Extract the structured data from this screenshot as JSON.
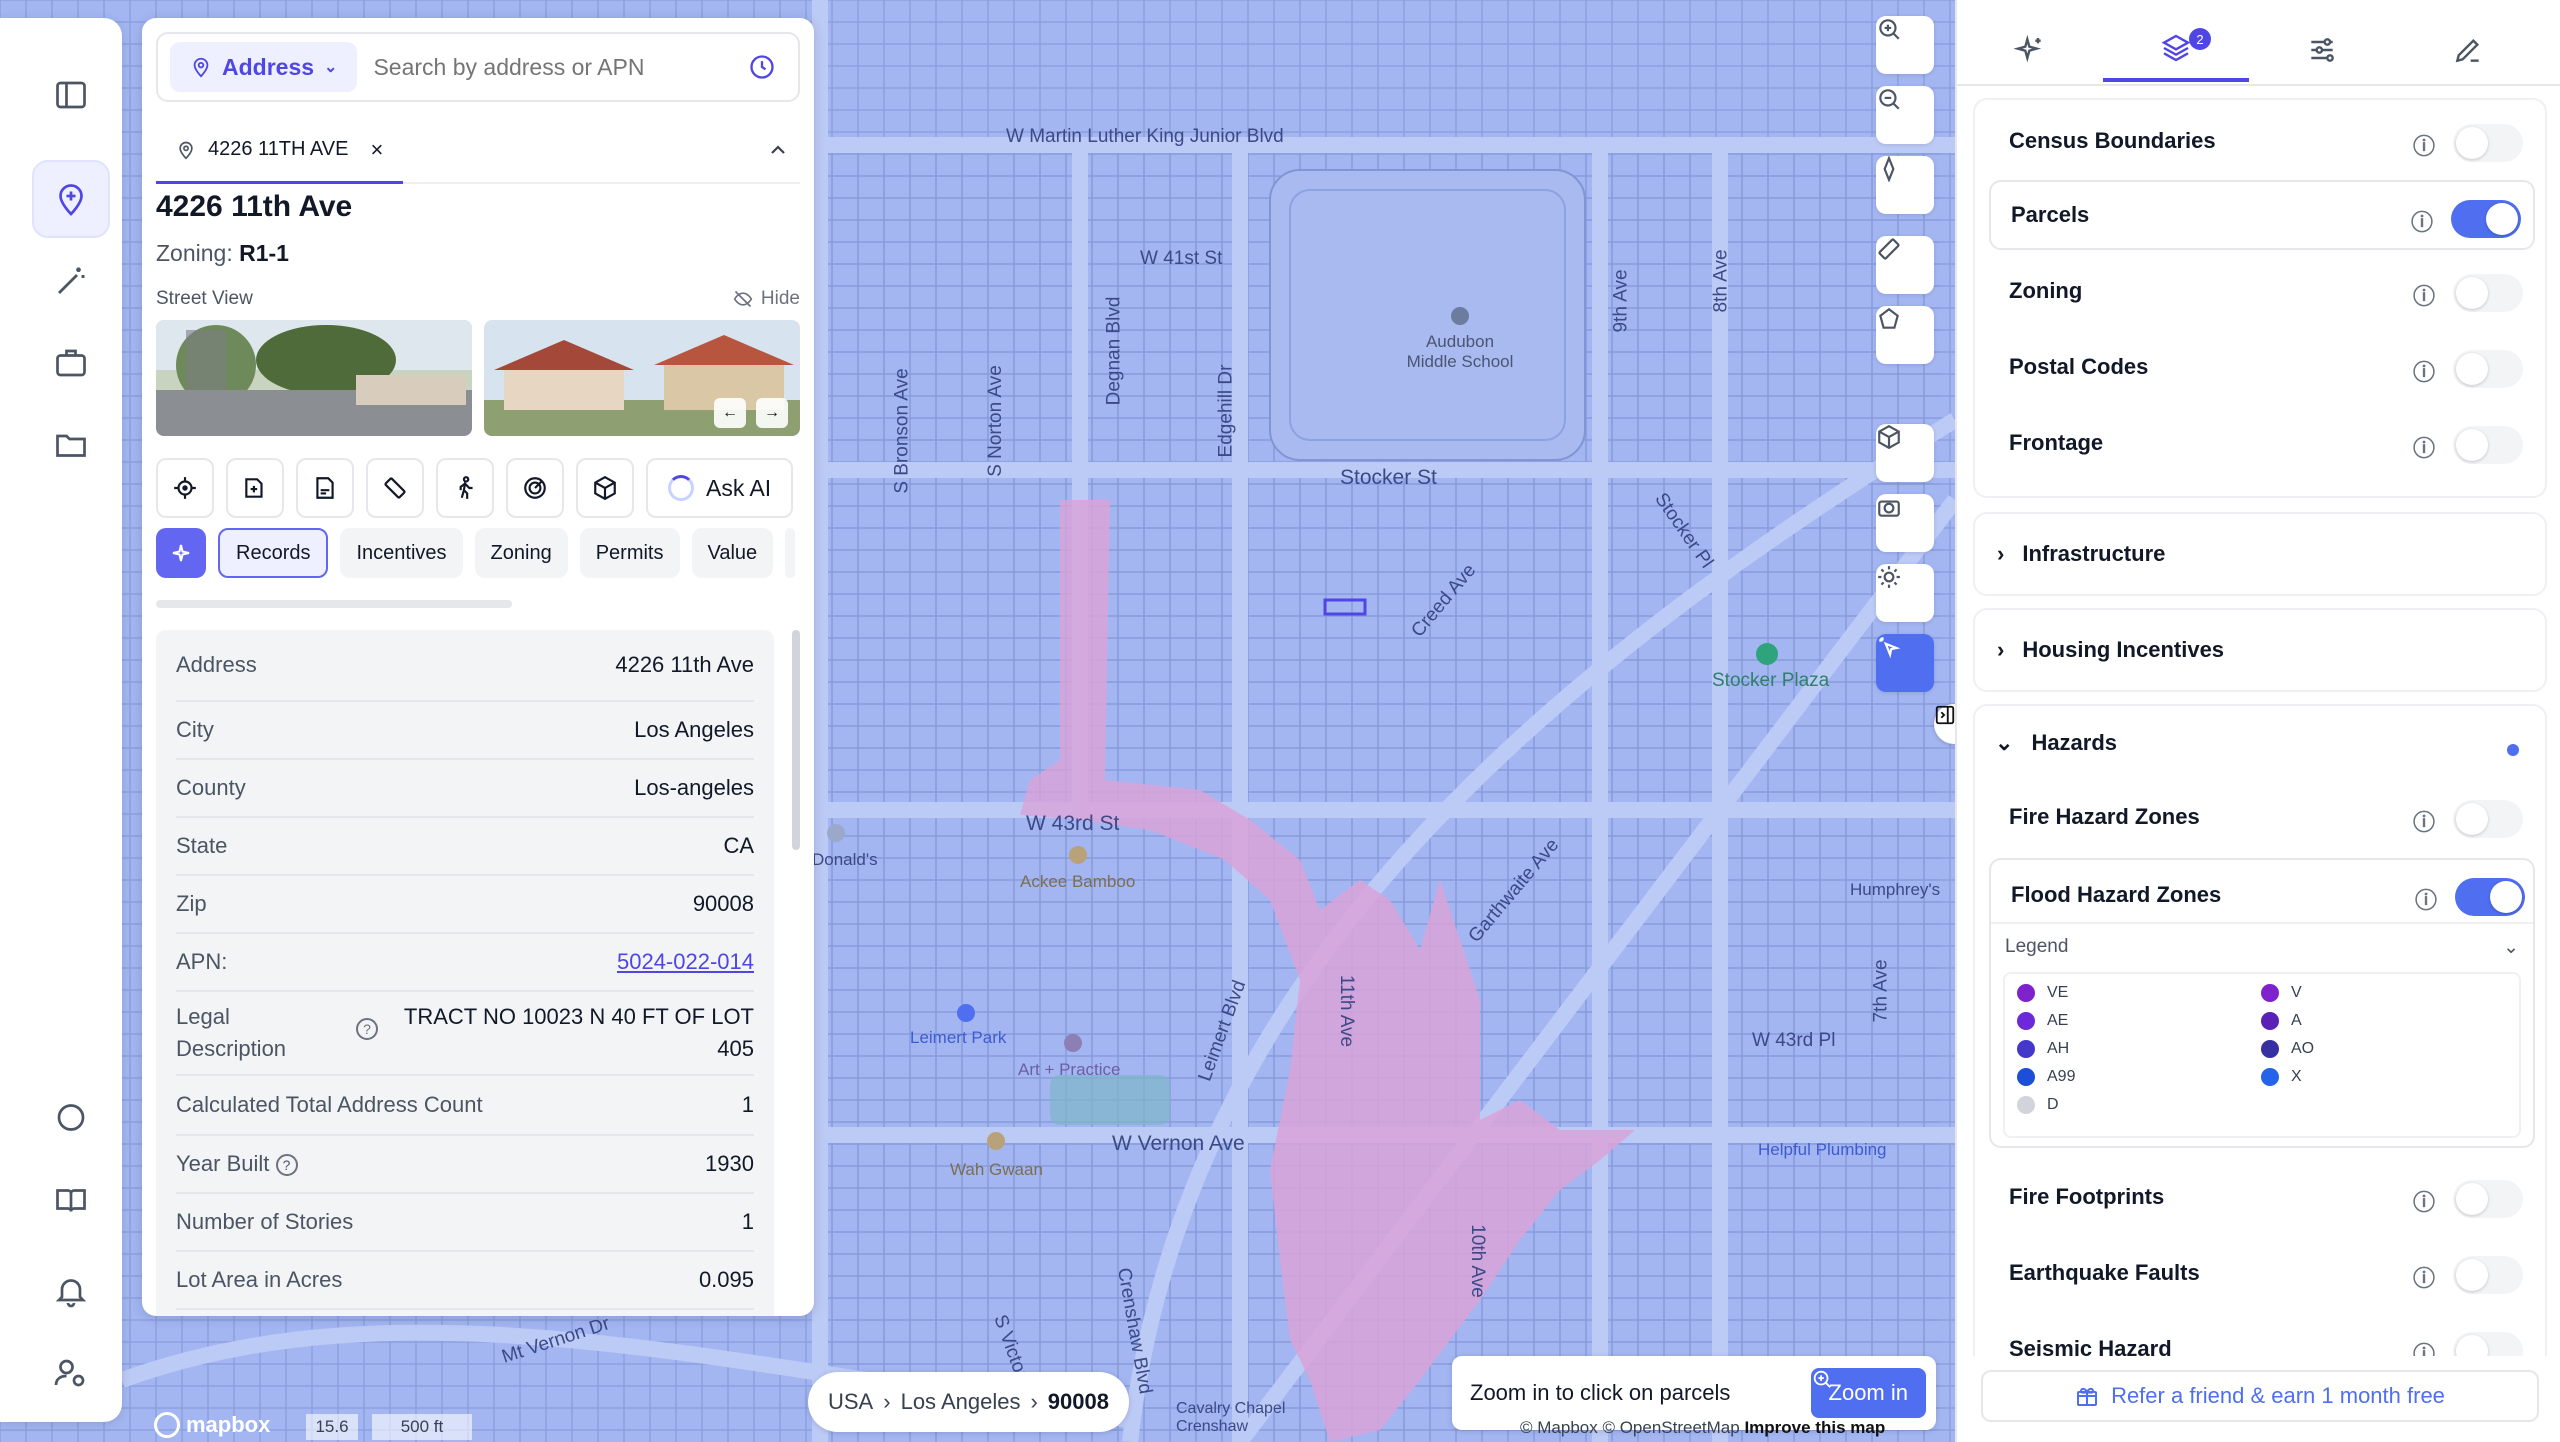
{
  "search": {
    "mode": "Address",
    "placeholder": "Search by address or APN"
  },
  "tab": {
    "label": "4226 11TH AVE"
  },
  "property": {
    "title": "4226 11th Ave",
    "zoning_label": "Zoning:",
    "zoning_value": "R1-1",
    "street_view_label": "Street View",
    "hide_label": "Hide"
  },
  "tools": {
    "ask_ai": "Ask AI"
  },
  "pills": [
    "Records",
    "Incentives",
    "Zoning",
    "Permits",
    "Value"
  ],
  "records": [
    {
      "key": "Address",
      "value": "4226 11th Ave"
    },
    {
      "key": "City",
      "value": "Los Angeles"
    },
    {
      "key": "County",
      "value": "Los-angeles"
    },
    {
      "key": "State",
      "value": "CA"
    },
    {
      "key": "Zip",
      "value": "90008"
    },
    {
      "key": "APN:",
      "value": "5024-022-014"
    },
    {
      "key": "Legal Description",
      "value": "TRACT NO 10023 N 40 FT OF LOT 405"
    },
    {
      "key": "Calculated Total Address Count",
      "value": "1"
    },
    {
      "key": "Year Built",
      "value": "1930"
    },
    {
      "key": "Number of Stories",
      "value": "1"
    },
    {
      "key": "Lot Area in Acres",
      "value": "0.095"
    }
  ],
  "map": {
    "labels": {
      "mlk": "W Martin Luther King Junior Blvd",
      "w41": "W 41st St",
      "stocker": "Stocker St",
      "stocker_pl": "Stocker Pl",
      "w43": "W 43rd St",
      "w43pl": "W 43rd Pl",
      "vernon": "W Vernon Ave",
      "mtvernon": "Mt Vernon Dr",
      "crenshaw": "Crenshaw Blvd",
      "leimert": "Leimert Blvd",
      "gardwaite": "Garthwaite Ave",
      "creed": "Creed Ave",
      "degnan": "Degnan Blvd",
      "edgehill": "Edgehill Dr",
      "norton": "S Norton Ave",
      "bronson": "S Bronson Ave",
      "audubon": "Audubon Middle School",
      "stocker_plaza": "Stocker Plaza",
      "ackee": "Ackee Bamboo",
      "leimert_park": "Leimert Park",
      "art": "Art + Practice",
      "wah": "Wah Gwaan",
      "helpful": "Helpful Plumbing",
      "humphrey": "Humphrey's",
      "cavalry": "Cavalry Chapel Crenshaw",
      "donald": "Donald's",
      "a11th": "11th Ave",
      "a10th": "10th Ave",
      "a9th": "9th Ave",
      "a8th": "8th Ave",
      "a7th": "7th Ave",
      "s_victoria": "S Victoria Ave"
    },
    "breadcrumb": [
      "USA",
      "Los Angeles",
      "90008"
    ],
    "zoom_hint": "Zoom in to click on parcels",
    "zoom_button": "Zoom in",
    "zoom_level": "15.6",
    "scale": "500 ft",
    "logo": "mapbox",
    "attribution": "© Mapbox © OpenStreetMap",
    "improve": "Improve this map"
  },
  "layers_badge": "2",
  "layers": [
    {
      "name": "Census Boundaries",
      "on": false
    },
    {
      "name": "Parcels",
      "on": true
    },
    {
      "name": "Zoning",
      "on": false
    },
    {
      "name": "Postal Codes",
      "on": false
    },
    {
      "name": "Frontage",
      "on": false
    }
  ],
  "sections": {
    "infrastructure": "Infrastructure",
    "housing": "Housing Incentives",
    "hazards": "Hazards"
  },
  "hazards": [
    {
      "name": "Fire Hazard Zones",
      "on": false
    },
    {
      "name": "Flood Hazard Zones",
      "on": true
    },
    {
      "name": "Fire Footprints",
      "on": false
    },
    {
      "name": "Earthquake Faults",
      "on": false
    },
    {
      "name": "Seismic Hazard",
      "on": false
    }
  ],
  "legend": {
    "title": "Legend",
    "items": [
      {
        "label": "VE",
        "color": "#7e22ce"
      },
      {
        "label": "V",
        "color": "#7e22ce"
      },
      {
        "label": "AE",
        "color": "#6d28d9"
      },
      {
        "label": "A",
        "color": "#5b21b6"
      },
      {
        "label": "AH",
        "color": "#4338ca"
      },
      {
        "label": "AO",
        "color": "#3730a3"
      },
      {
        "label": "A99",
        "color": "#1d4ed8"
      },
      {
        "label": "X",
        "color": "#2563eb"
      },
      {
        "label": "D",
        "color": "#d1d5db"
      }
    ]
  },
  "refer": "Refer a friend & earn 1 month free",
  "colors": {
    "accent": "#4f46e5",
    "map": "#9eb3f2",
    "flood": "#d9a3d8"
  }
}
